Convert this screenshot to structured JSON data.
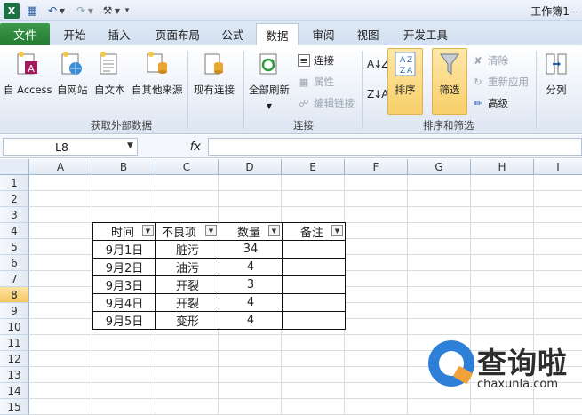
{
  "window": {
    "title": "工作簿1 -"
  },
  "quick_access": {
    "app_icon": "excel-logo-icon",
    "logo_text": "X"
  },
  "tabs": [
    "文件",
    "开始",
    "插入",
    "页面布局",
    "公式",
    "数据",
    "审阅",
    "视图",
    "开发工具"
  ],
  "active_tab": "数据",
  "ribbon": {
    "get_external": {
      "access": "自 Access",
      "web": "自网站",
      "text": "自文本",
      "other": "自其他来源",
      "existing": "现有连接",
      "group_label": "获取外部数据"
    },
    "connections": {
      "refresh_all": "全部刷新",
      "connections": "连接",
      "properties": "属性",
      "edit_links": "编辑链接",
      "group_label": "连接"
    },
    "sort_filter": {
      "sort": "排序",
      "filter": "筛选",
      "clear": "清除",
      "reapply": "重新应用",
      "advanced": "高级",
      "group_label": "排序和筛选"
    },
    "data_tools": {
      "split": "分列"
    }
  },
  "formula_bar": {
    "name_box": "L8",
    "fx": "fx",
    "formula": ""
  },
  "columns": [
    "A",
    "B",
    "C",
    "D",
    "E",
    "F",
    "G",
    "H",
    "I"
  ],
  "rows": [
    "1",
    "2",
    "3",
    "4",
    "5",
    "6",
    "7",
    "8",
    "9",
    "10",
    "11",
    "12",
    "13",
    "14",
    "15"
  ],
  "selected_row": "8",
  "table": {
    "headers": [
      "时间",
      "不良项",
      "数量",
      "备注"
    ],
    "rows": [
      [
        "9月1日",
        "脏污",
        "34",
        ""
      ],
      [
        "9月2日",
        "油污",
        "4",
        ""
      ],
      [
        "9月3日",
        "开裂",
        "3",
        ""
      ],
      [
        "9月4日",
        "开裂",
        "4",
        ""
      ],
      [
        "9月5日",
        "变形",
        "4",
        ""
      ]
    ]
  },
  "watermark": {
    "title": "查询啦",
    "url": "chaxunla.com"
  },
  "colors": {
    "file_tab": "#2e8b3c",
    "active_highlight": "#f8cf6a",
    "watermark_blue": "#2e7fd8",
    "watermark_orange": "#f2a23a"
  }
}
